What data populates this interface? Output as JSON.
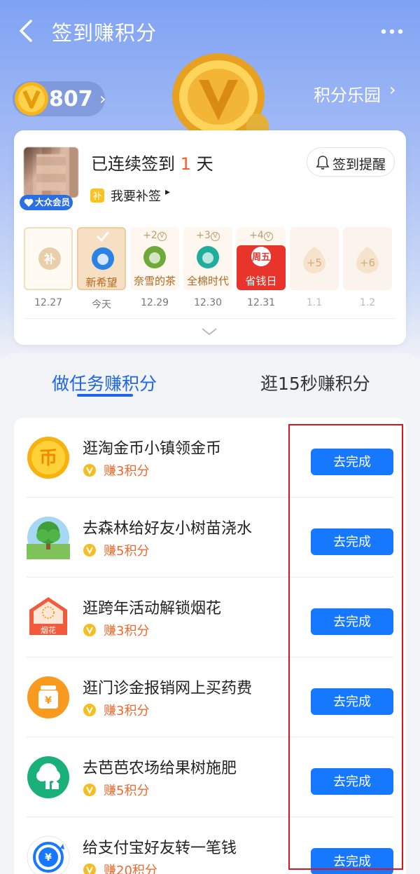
{
  "header": {
    "title": "签到赚积分"
  },
  "points": {
    "count": "807"
  },
  "park": {
    "label": "积分乐园"
  },
  "signin": {
    "vip_label": "大众会员",
    "streak_prefix": "已连续签到",
    "streak_days": "1",
    "streak_suffix": "天",
    "makeup_label": "我要补签",
    "remind_label": "签到提醒"
  },
  "days": [
    {
      "bonus": "",
      "name": "",
      "logo": "补",
      "date": "12.27"
    },
    {
      "bonus": "",
      "name": "新希望",
      "logo": "check",
      "date": "今天"
    },
    {
      "bonus": "+2",
      "name": "奈雪的茶",
      "logo": "green",
      "date": "12.29"
    },
    {
      "bonus": "+3",
      "name": "全棉时代",
      "logo": "teal",
      "date": "12.30"
    },
    {
      "bonus": "+4",
      "name": "省钱日",
      "logo": "周五",
      "date": "12.31"
    },
    {
      "bonus": "",
      "name": "",
      "logo": "+5",
      "date": "1.1"
    },
    {
      "bonus": "",
      "name": "",
      "logo": "+6",
      "date": "1.2"
    }
  ],
  "tabs": [
    {
      "label": "做任务赚积分"
    },
    {
      "label": "逛15秒赚积分"
    }
  ],
  "tasks": [
    {
      "title": "逛淘金币小镇领金币",
      "points": "赚3积分",
      "button": "去完成",
      "icon": "coin-icon"
    },
    {
      "title": "去森林给好友小树苗浇水",
      "points": "赚5积分",
      "button": "去完成",
      "icon": "tree-icon"
    },
    {
      "title": "逛跨年活动解锁烟花",
      "points": "赚3积分",
      "button": "去完成",
      "icon": "firework-icon",
      "icon_text": "烟花"
    },
    {
      "title": "逛门诊金报销网上买药费",
      "points": "赚3积分",
      "button": "去完成",
      "icon": "medicine-jar-icon",
      "icon_text": "¥"
    },
    {
      "title": "去芭芭农场给果树施肥",
      "points": "赚5积分",
      "button": "去完成",
      "icon": "farm-tree-icon"
    },
    {
      "title": "给支付宝好友转一笔钱",
      "points": "赚20积分",
      "button": "去完成",
      "icon": "transfer-icon",
      "icon_text": "¥"
    }
  ],
  "colors": {
    "accent": "#1677ff",
    "points_orange": "#f0692c",
    "highlight_red": "#e0131a"
  }
}
